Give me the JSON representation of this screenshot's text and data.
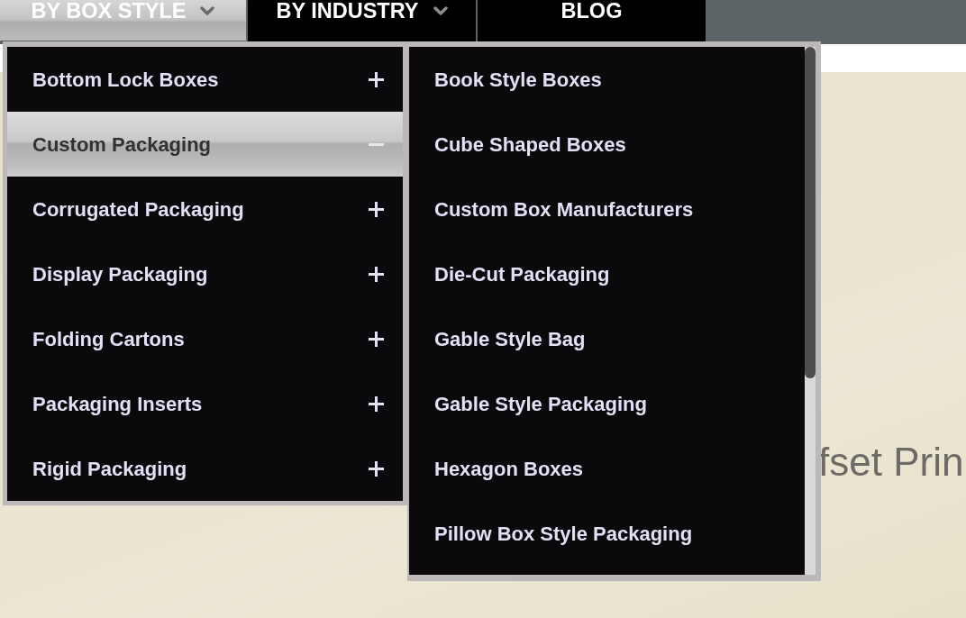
{
  "nav": {
    "tabs": [
      {
        "label": "BY BOX STYLE",
        "selected": true,
        "dropdown": true
      },
      {
        "label": "BY INDUSTRY",
        "selected": false,
        "dropdown": true
      },
      {
        "label": "BLOG",
        "selected": false,
        "dropdown": false
      }
    ]
  },
  "menu": {
    "categories": [
      {
        "label": "Bottom Lock Boxes",
        "expanded": false
      },
      {
        "label": "Custom Packaging",
        "expanded": true
      },
      {
        "label": "Corrugated Packaging",
        "expanded": false
      },
      {
        "label": "Display Packaging",
        "expanded": false
      },
      {
        "label": "Folding Cartons",
        "expanded": false
      },
      {
        "label": "Packaging Inserts",
        "expanded": false
      },
      {
        "label": "Rigid Packaging",
        "expanded": false
      }
    ],
    "subcategories": [
      "Book Style Boxes",
      "Cube Shaped Boxes",
      "Custom Box Manufacturers",
      "Die-Cut Packaging",
      "Gable Style Bag",
      "Gable Style Packaging",
      "Hexagon Boxes",
      "Pillow Box Style Packaging"
    ]
  },
  "hero": {
    "heading": "fset Prin"
  }
}
